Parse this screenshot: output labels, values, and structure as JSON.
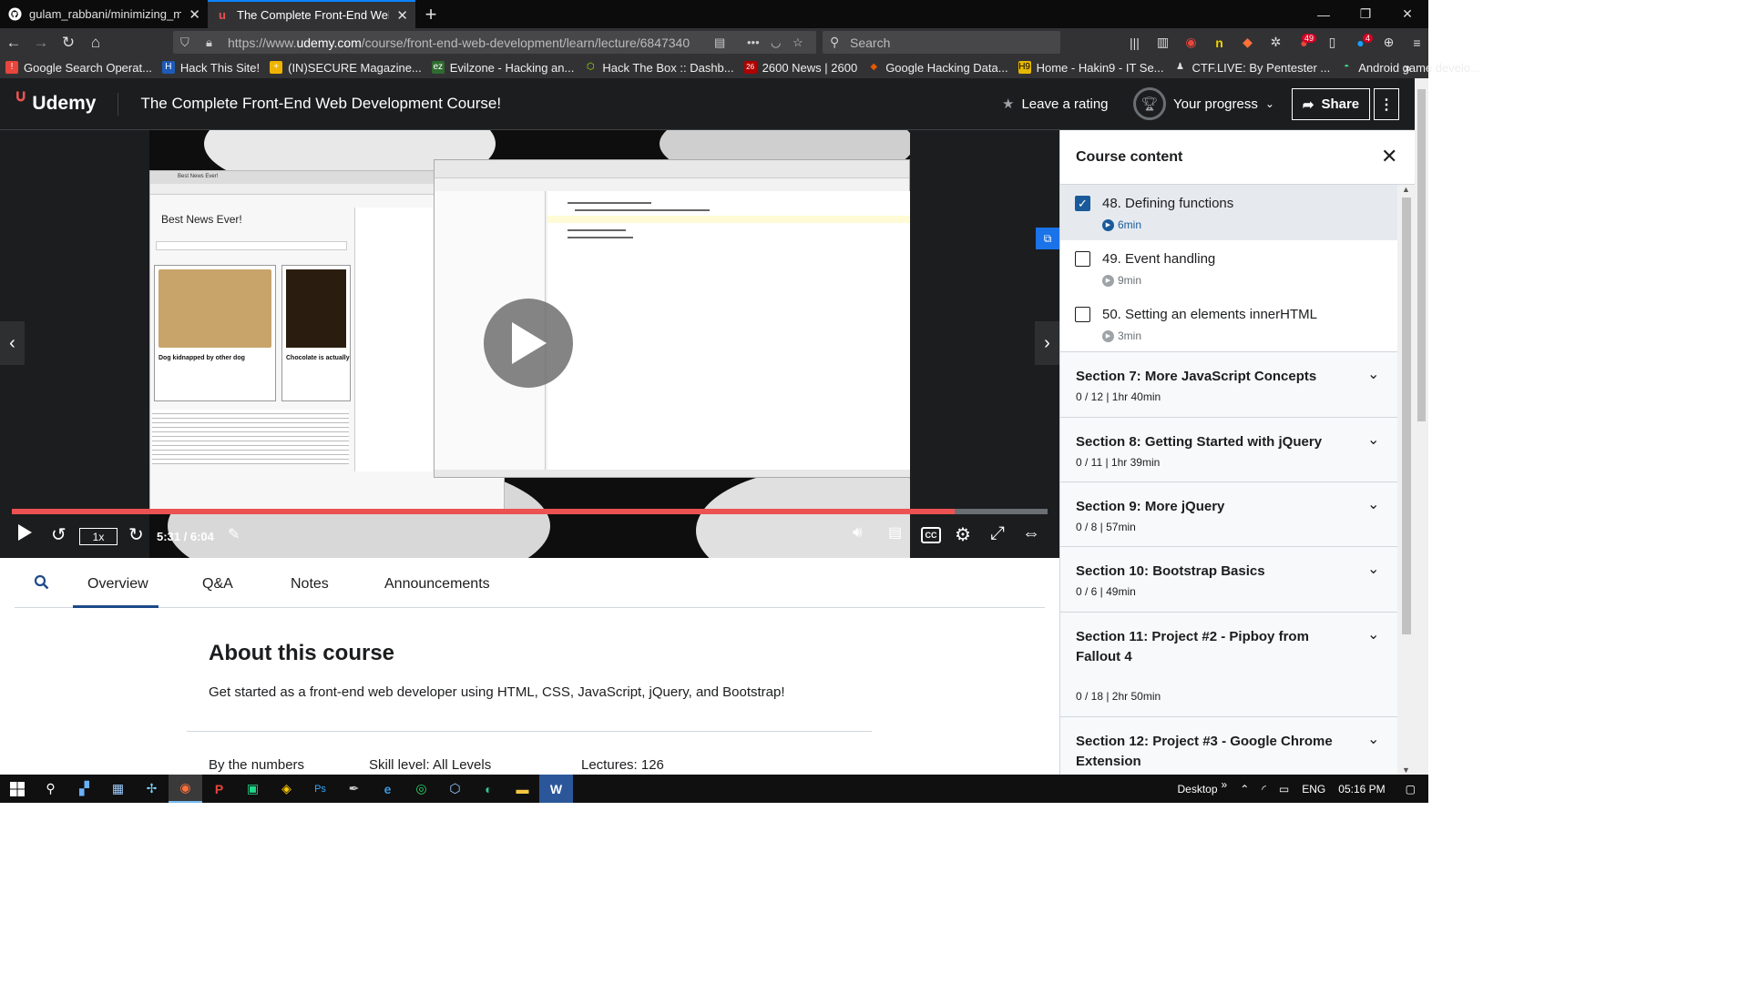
{
  "browser": {
    "tabs": [
      {
        "title": "gulam_rabbani/minimizing_ma",
        "icon": "github-icon",
        "active": false
      },
      {
        "title": "The Complete Front-End Web D",
        "icon": "udemy-icon",
        "active": true
      }
    ],
    "url_prefix": "https://www.",
    "url_domain": "udemy.com",
    "url_path": "/course/front-end-web-development/learn/lecture/6847340",
    "search_placeholder": "Search",
    "badges": {
      "ext1": "49",
      "ext2": "4"
    },
    "bookmarks": [
      {
        "label": "Google Search Operat...",
        "icon_color": "#e8453c"
      },
      {
        "label": "Hack This Site!",
        "icon_color": "#1e5bb8"
      },
      {
        "label": "(IN)SECURE Magazine...",
        "icon_color": "#f0b400"
      },
      {
        "label": "Evilzone - Hacking an...",
        "icon_color": "#2f6b2f"
      },
      {
        "label": "Hack The Box :: Dashb...",
        "icon_color": "#9fef00"
      },
      {
        "label": "2600 News | 2600",
        "icon_color": "#b00000"
      },
      {
        "label": "Google Hacking Data...",
        "icon_color": "#e45a00"
      },
      {
        "label": "Home - Hakin9 - IT Se...",
        "icon_color": "#e5b800"
      },
      {
        "label": "CTF.LIVE: By Pentester ...",
        "icon_color": "#dddddd"
      },
      {
        "label": "Android game develo...",
        "icon_color": "#3ddc84"
      }
    ]
  },
  "header": {
    "logo_text": "Udemy",
    "course_title": "The Complete Front-End Web Development Course!",
    "leave_rating": "Leave a rating",
    "your_progress": "Your progress",
    "share": "Share"
  },
  "player": {
    "speed": "1x",
    "time": "5:31 / 6:04",
    "progress_fraction": 0.91,
    "cc": "CC"
  },
  "tabs": {
    "overview": "Overview",
    "qa": "Q&A",
    "notes": "Notes",
    "announcements": "Announcements"
  },
  "about": {
    "title": "About this course",
    "description": "Get started as a front-end web developer using HTML, CSS, JavaScript, jQuery, and Bootstrap!",
    "by_numbers": "By the numbers",
    "skill_level": "Skill level: All Levels",
    "lectures": "Lectures: 126"
  },
  "sidebar": {
    "title": "Course content",
    "lectures": [
      {
        "title": "48. Defining functions",
        "duration": "6min",
        "checked": true,
        "current": true
      },
      {
        "title": "49. Event handling",
        "duration": "9min",
        "checked": false,
        "current": false
      },
      {
        "title": "50. Setting an elements innerHTML",
        "duration": "3min",
        "checked": false,
        "current": false
      }
    ],
    "sections": [
      {
        "title": "Section 7: More JavaScript Concepts",
        "meta": "0 / 12 | 1hr 40min"
      },
      {
        "title": "Section 8: Getting Started with jQuery",
        "meta": "0 / 11 | 1hr 39min"
      },
      {
        "title": "Section 9: More jQuery",
        "meta": "0 / 8 | 57min"
      },
      {
        "title": "Section 10: Bootstrap Basics",
        "meta": "0 / 6 | 49min"
      },
      {
        "title": "Section 11: Project #2 - Pipboy from Fallout 4",
        "meta": "0 / 18 | 2hr 50min"
      },
      {
        "title": "Section 12: Project #3 - Google Chrome Extension",
        "meta": ""
      }
    ]
  },
  "video_content": {
    "left_window_title": "Best News Ever!",
    "card1_title": "Dog kidnapped by other dog",
    "card2_title": "Chocolate is actually g"
  },
  "taskbar": {
    "desktop": "Desktop",
    "lang": "ENG",
    "clock": "05:16 PM"
  }
}
